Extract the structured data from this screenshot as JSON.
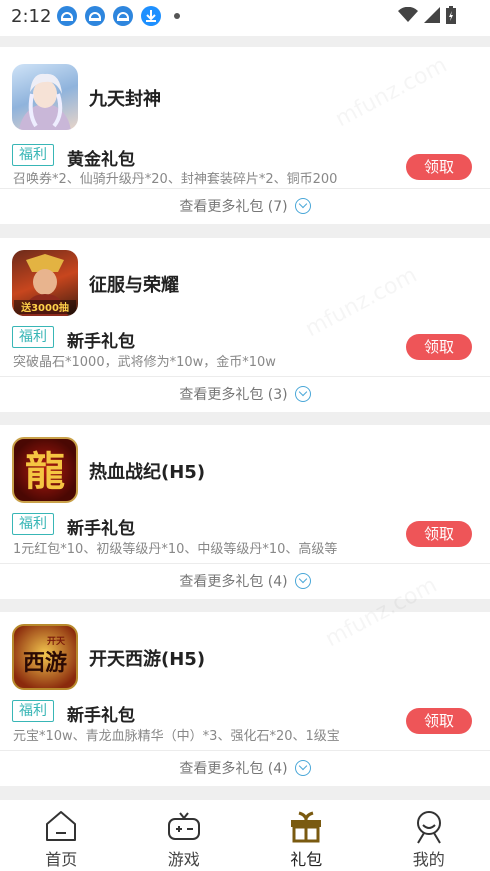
{
  "status_bar": {
    "time": "2:12"
  },
  "gifts": [
    {
      "game": "九天封神",
      "tag": "福利",
      "title": "黄金礼包",
      "desc": "召唤券*2、仙骑升级丹*20、封神套装碎片*2、铜币200",
      "button": "领取",
      "more": "查看更多礼包 (7)"
    },
    {
      "game": "征服与荣耀",
      "tag": "福利",
      "title": "新手礼包",
      "desc": "突破晶石*1000，武将修为*10w，金币*10w",
      "button": "领取",
      "more": "查看更多礼包 (3)",
      "icon_badge": "送3000抽"
    },
    {
      "game": "热血战纪(H5)",
      "tag": "福利",
      "title": "新手礼包",
      "desc": "1元红包*10、初级等级丹*10、中级等级丹*10、高级等",
      "button": "领取",
      "more": "查看更多礼包 (4)",
      "icon_glyph": "龍"
    },
    {
      "game": "开天西游(H5)",
      "tag": "福利",
      "title": "新手礼包",
      "desc": "元宝*10w、青龙血脉精华（中）*3、强化石*20、1级宝",
      "button": "领取",
      "more": "查看更多礼包 (4)",
      "icon_glyph": "西游",
      "icon_small": "开天"
    }
  ],
  "tabbar": [
    {
      "label": "首页",
      "icon": "home-icon"
    },
    {
      "label": "游戏",
      "icon": "gamepad-icon"
    },
    {
      "label": "礼包",
      "icon": "gift-icon",
      "active": true
    },
    {
      "label": "我的",
      "icon": "user-icon"
    }
  ],
  "colors": {
    "accent": "#ee5558",
    "tag": "#38b6b6",
    "more_icon": "#4aa7d8",
    "active_tab": "#7a5a10"
  },
  "watermark": "mfunz.com"
}
